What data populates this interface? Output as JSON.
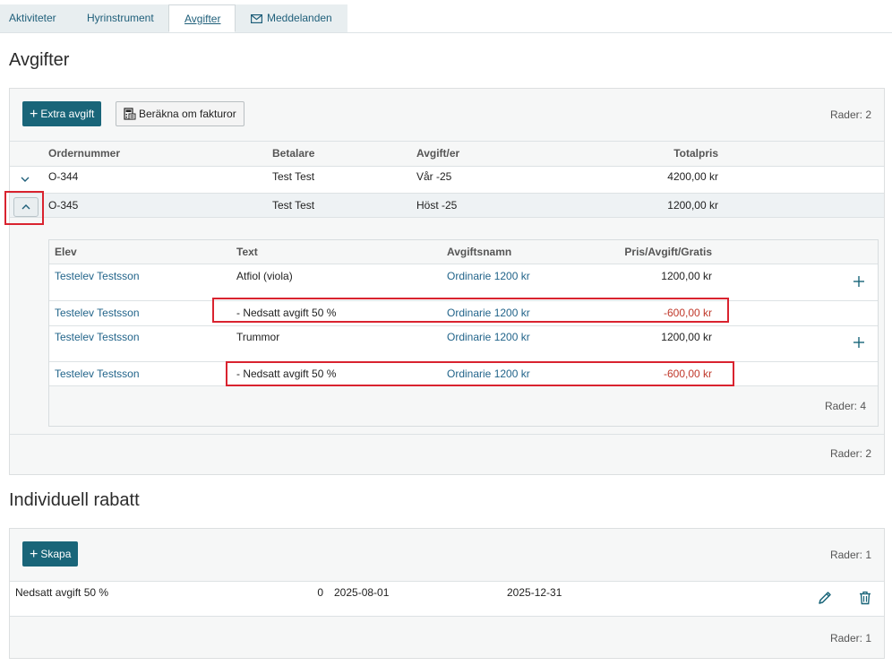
{
  "tabs": [
    {
      "label": "Aktiviteter"
    },
    {
      "label": "Hyrinstrument"
    },
    {
      "label": "Avgifter"
    },
    {
      "label": "Meddelanden"
    }
  ],
  "fees_section": {
    "title": "Avgifter",
    "extra_fee_label": "Extra avgift",
    "recalc_label": "Beräkna om fakturor",
    "rows_count_top": "Rader: 2",
    "rows_count_bottom": "Rader: 2",
    "columns": [
      "Ordernummer",
      "Betalare",
      "Avgift/er",
      "Totalpris"
    ],
    "orders": [
      {
        "order": "O-344",
        "payer": "Test Test",
        "fee": "Vår -25",
        "total": "4200,00 kr",
        "expanded": false
      },
      {
        "order": "O-345",
        "payer": "Test Test",
        "fee": "Höst -25",
        "total": "1200,00 kr",
        "expanded": true
      }
    ],
    "detail": {
      "columns": [
        "Elev",
        "Text",
        "Avgiftsnamn",
        "Pris/Avgift/Gratis"
      ],
      "rows": [
        {
          "student": "Testelev Testsson",
          "text": "Atfiol (viola)",
          "fee_name": "Ordinarie 1200 kr",
          "price": "1200,00 kr"
        },
        {
          "student": "Testelev Testsson",
          "text": "- Nedsatt avgift 50 %",
          "fee_name": "Ordinarie 1200 kr",
          "price": "-600,00 kr"
        },
        {
          "student": "Testelev Testsson",
          "text": "Trummor",
          "fee_name": "Ordinarie 1200 kr",
          "price": "1200,00 kr"
        },
        {
          "student": "Testelev Testsson",
          "text": "- Nedsatt avgift 50 %",
          "fee_name": "Ordinarie 1200 kr",
          "price": "-600,00 kr"
        }
      ],
      "rows_count": "Rader: 4"
    }
  },
  "discount_section": {
    "title": "Individuell rabatt",
    "create_label": "Skapa",
    "rows_count_top": "Rader: 1",
    "rows_count_bottom": "Rader: 1",
    "row": {
      "name": "Nedsatt avgift 50 %",
      "value": "0",
      "start": "2025-08-01",
      "end": "2025-12-31"
    }
  },
  "colors": {
    "primary": "#196579",
    "link": "#22648a",
    "negative": "#c0392b",
    "highlight": "#d9232f"
  },
  "icons": [
    "envelope-icon",
    "plus-icon",
    "calculator-icon",
    "chevron-down-icon",
    "chevron-up-icon",
    "pencil-icon",
    "trash-icon"
  ]
}
